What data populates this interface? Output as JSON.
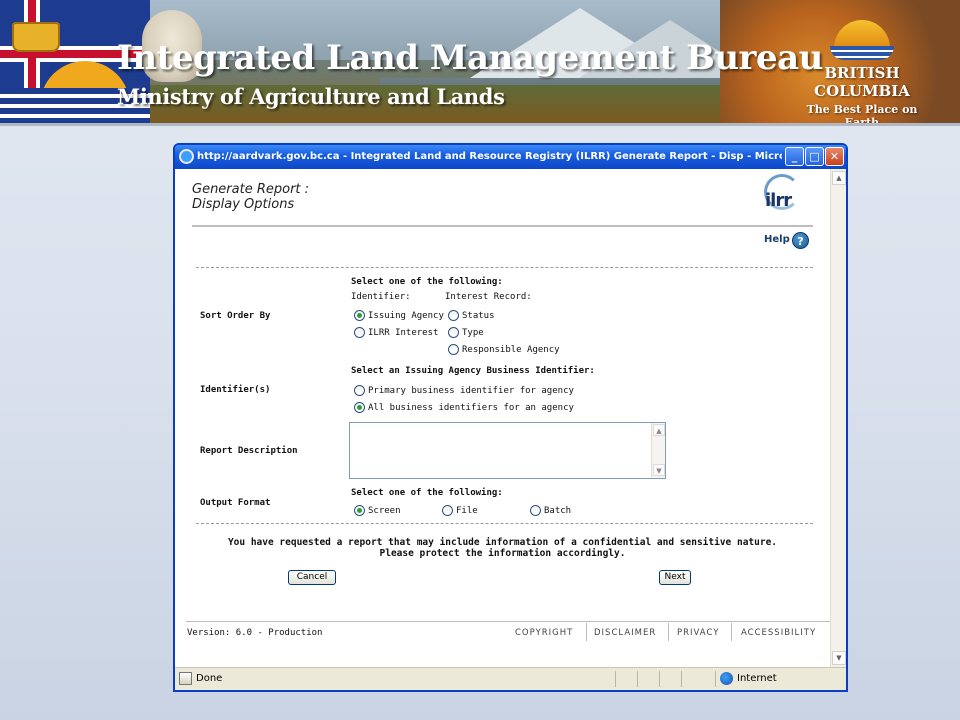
{
  "banner": {
    "title": "Integrated Land Management Bureau",
    "subtitle": "Ministry of Agriculture and Lands",
    "logo_line1": "BRITISH",
    "logo_line2": "COLUMBIA",
    "logo_tagline": "The Best Place on Earth"
  },
  "window": {
    "title": "http://aardvark.gov.bc.ca - Integrated Land and Resource Registry (ILRR) Generate Report - Disp - Microsoft Int...",
    "status_text": "Done",
    "zone_text": "Internet"
  },
  "page": {
    "heading_line1": "Generate Report :",
    "heading_line2": "Display Options",
    "logo_text": "ilrr",
    "help_label": "Help",
    "help_icon": "?"
  },
  "sort": {
    "label": "Sort Order By",
    "instruction": "Select one of the following:",
    "col1_header": "Identifier:",
    "col2_header": "Interest Record:",
    "options": {
      "issuing_agency": "Issuing Agency",
      "ilrr_interest": "ILRR Interest",
      "status": "Status",
      "type": "Type",
      "responsible_agency": "Responsible Agency"
    },
    "selected": "Issuing Agency"
  },
  "identifiers": {
    "label": "Identifier(s)",
    "instruction": "Select an Issuing Agency Business Identifier:",
    "opt_primary": "Primary business identifier for agency",
    "opt_all": "All business identifiers for an agency",
    "selected": "All business identifiers for an agency"
  },
  "description": {
    "label": "Report Description",
    "value": ""
  },
  "output": {
    "label": "Output Format",
    "instruction": "Select one of the following:",
    "opt_screen": "Screen",
    "opt_file": "File",
    "opt_batch": "Batch",
    "selected": "Screen"
  },
  "notice": {
    "line1": "You have requested a report that may include information of a confidential and sensitive nature.",
    "line2": "Please protect the information accordingly."
  },
  "buttons": {
    "cancel": "Cancel",
    "next": "Next"
  },
  "footer": {
    "version": "Version: 6.0 - Production",
    "copyright": "COPYRIGHT",
    "disclaimer": "DISCLAIMER",
    "privacy": "PRIVACY",
    "accessibility": "ACCESSIBILITY"
  },
  "icons": {
    "app": "internet-explorer-icon",
    "help": "help-icon",
    "zone": "globe-icon"
  }
}
